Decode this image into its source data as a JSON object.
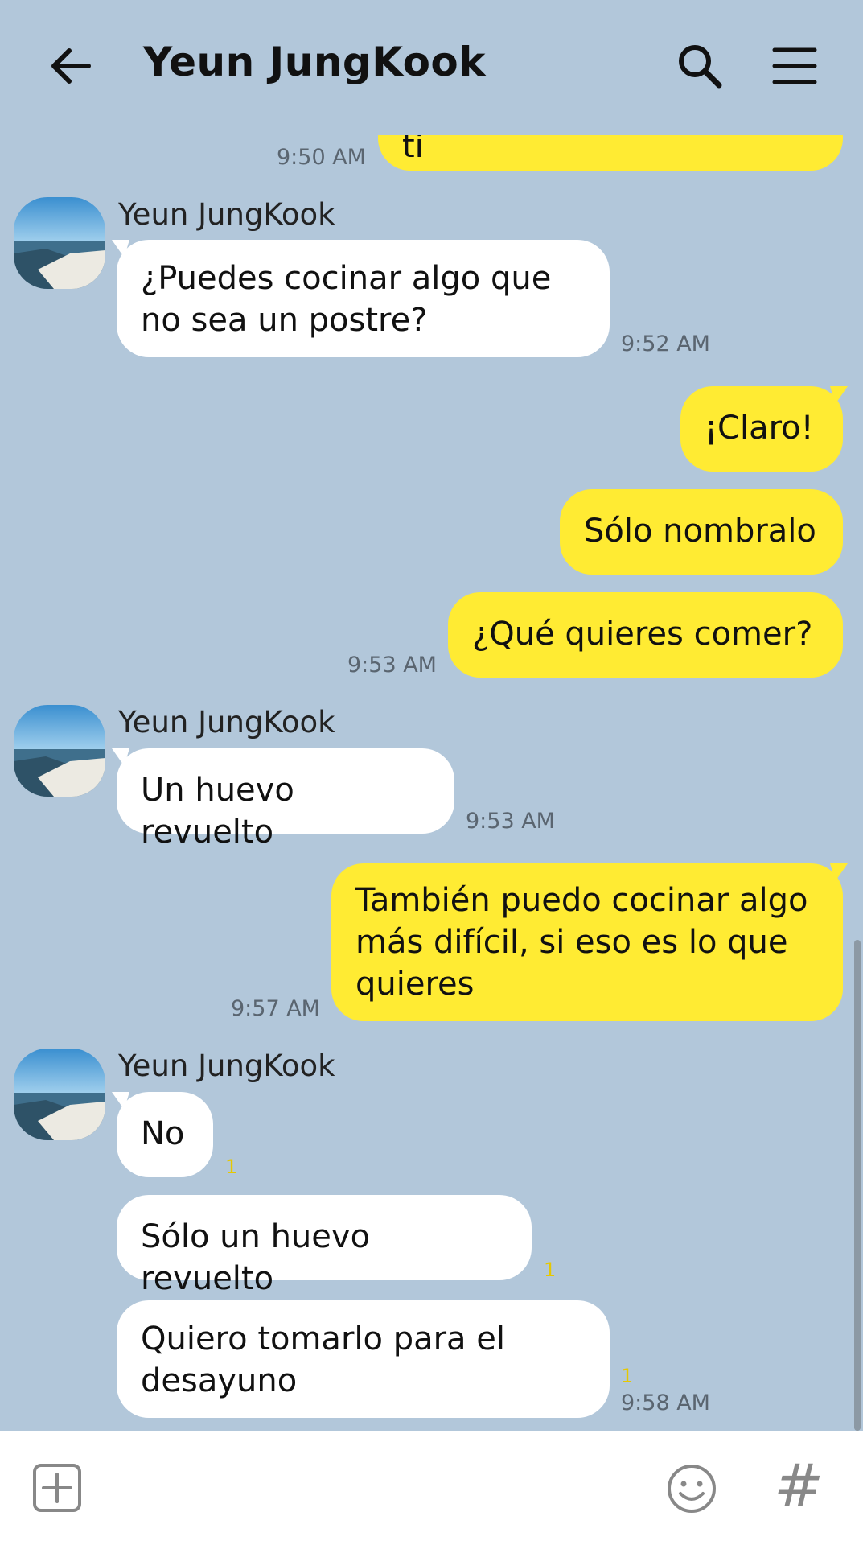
{
  "header": {
    "title": "Yeun JungKook"
  },
  "messages": {
    "m0": {
      "text": "Puedo cocinar algo para ti",
      "time": "9:50 AM"
    },
    "g1": {
      "name": "Yeun JungKook",
      "text_line1": "¿Puedes cocinar algo que",
      "text_line2": "no sea un postre?",
      "time": "9:52 AM"
    },
    "m1": {
      "text": "¡Claro!"
    },
    "m2": {
      "text": "Sólo nombralo"
    },
    "m3": {
      "text": "¿Qué quieres comer?",
      "time": "9:53 AM"
    },
    "g2": {
      "name": "Yeun JungKook",
      "text": "Un huevo revuelto",
      "time": "9:53 AM"
    },
    "m4": {
      "text_line1": "También puedo cocinar algo",
      "text_line2": "más difícil, si eso es lo que",
      "text_line3": "quieres",
      "time": "9:57 AM"
    },
    "g3": {
      "name": "Yeun JungKook"
    },
    "g3a": {
      "text": "No",
      "unread": "1"
    },
    "g3b": {
      "text": "Sólo un huevo revuelto",
      "unread": "1"
    },
    "g3c": {
      "text_line1": "Quiero tomarlo para el",
      "text_line2": "desayuno",
      "unread": "1",
      "time": "9:58 AM"
    }
  },
  "composer": {
    "hash_label": "#"
  },
  "colors": {
    "background": "#b2c7da",
    "my_bubble": "#ffeb33",
    "their_bubble": "#ffffff",
    "unread": "#e6c800"
  },
  "icons": [
    "back-arrow-icon",
    "search-icon",
    "menu-icon",
    "plus-icon",
    "emoji-icon",
    "hash-icon"
  ]
}
